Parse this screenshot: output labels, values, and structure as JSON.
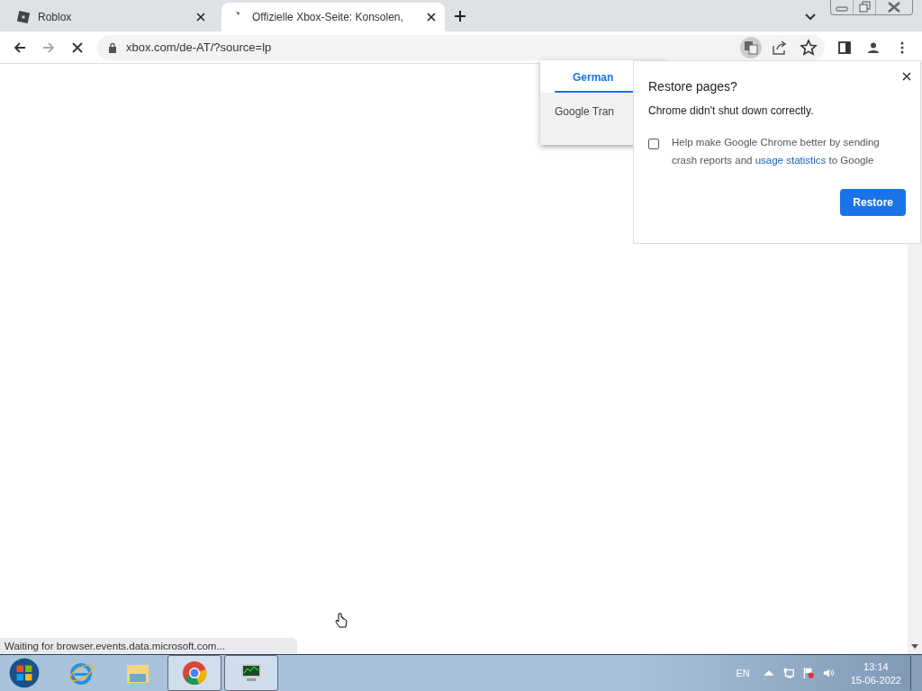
{
  "tabs": [
    {
      "title": "Roblox",
      "selected": false,
      "loading": false
    },
    {
      "title": "Offizielle Xbox-Seite: Konsolen,",
      "selected": true,
      "loading": true
    }
  ],
  "address": "xbox.com/de-AT/?source=lp",
  "translate_popup": {
    "tab": "German",
    "footer": "Google Tran"
  },
  "dialog": {
    "title": "Restore pages?",
    "message": "Chrome didn't shut down correctly.",
    "checkbox": {
      "checked": false,
      "text_before": "Help make Google Chrome better by sending crash reports and",
      "link": "usage statistics",
      "text_after": "to Google"
    },
    "button": "Restore"
  },
  "status_bar": "Waiting for browser.events.data.microsoft.com...",
  "taskbar": {
    "apps": [
      {
        "kind": "ie",
        "open": false
      },
      {
        "kind": "explorer",
        "open": false
      },
      {
        "kind": "chrome",
        "open": true
      },
      {
        "kind": "monitor",
        "open": true
      }
    ],
    "language": "EN",
    "time": "13:14",
    "date": "15-06-2022"
  }
}
